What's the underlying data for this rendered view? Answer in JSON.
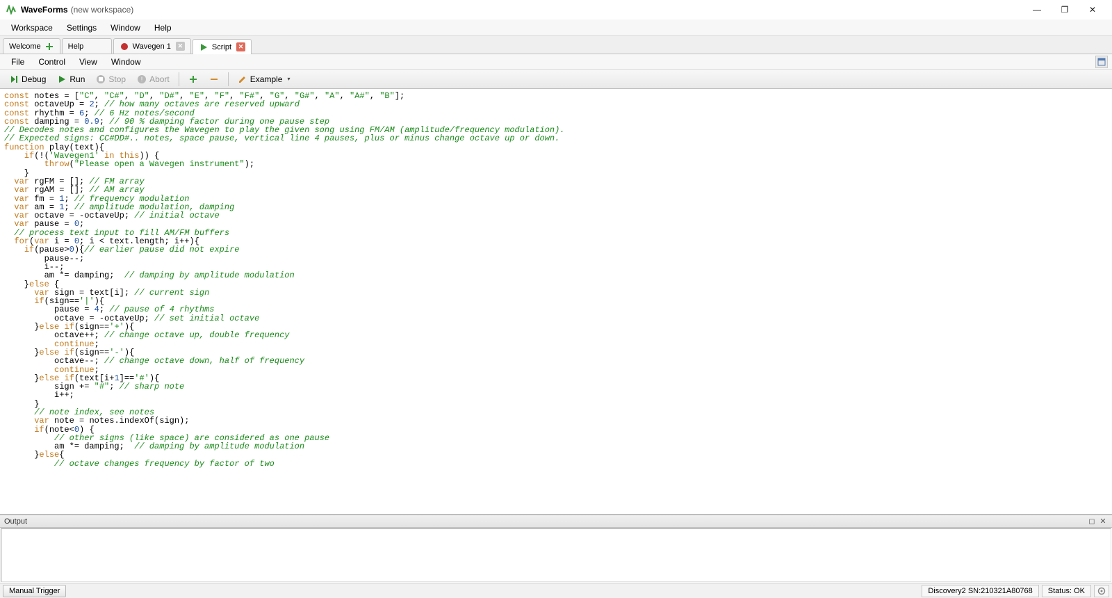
{
  "title": {
    "app": "WaveForms",
    "workspace": "(new workspace)"
  },
  "window_buttons": {
    "min": "—",
    "max": "❐",
    "close": "✕"
  },
  "menubar": [
    "Workspace",
    "Settings",
    "Window",
    "Help"
  ],
  "tabs": [
    {
      "label": "Welcome",
      "icon": "plus-green",
      "active": false,
      "closable": false
    },
    {
      "label": "Help",
      "icon": "",
      "active": false,
      "closable": false
    },
    {
      "label": "Wavegen 1",
      "icon": "record-red",
      "active": false,
      "closable": "grey"
    },
    {
      "label": "Script",
      "icon": "play-green",
      "active": true,
      "closable": "red"
    }
  ],
  "sub_menubar": [
    "File",
    "Control",
    "View",
    "Window"
  ],
  "toolbar": {
    "debug": "Debug",
    "run": "Run",
    "stop": "Stop",
    "abort": "Abort",
    "example": "Example"
  },
  "output": {
    "title": "Output"
  },
  "statusbar": {
    "manual_trigger": "Manual Trigger",
    "device": "Discovery2 SN:210321A80768",
    "status": "Status: OK"
  },
  "code_lines": [
    [
      [
        "kw",
        "const"
      ],
      [
        "",
        "",
        " notes = ["
      ],
      [
        "str",
        "\"C\""
      ],
      [
        "",
        ", "
      ],
      [
        "str",
        "\"C#\""
      ],
      [
        "",
        ", "
      ],
      [
        "str",
        "\"D\""
      ],
      [
        "",
        ", "
      ],
      [
        "str",
        "\"D#\""
      ],
      [
        "",
        ", "
      ],
      [
        "str",
        "\"E\""
      ],
      [
        "",
        ", "
      ],
      [
        "str",
        "\"F\""
      ],
      [
        "",
        ", "
      ],
      [
        "str",
        "\"F#\""
      ],
      [
        "",
        ", "
      ],
      [
        "str",
        "\"G\""
      ],
      [
        "",
        ", "
      ],
      [
        "str",
        "\"G#\""
      ],
      [
        "",
        ", "
      ],
      [
        "str",
        "\"A\""
      ],
      [
        "",
        ", "
      ],
      [
        "str",
        "\"A#\""
      ],
      [
        "",
        ", "
      ],
      [
        "str",
        "\"B\""
      ],
      [
        "",
        "];"
      ]
    ],
    [
      [
        "kw",
        "const"
      ],
      [
        "",
        " octaveUp = "
      ],
      [
        "num",
        "2"
      ],
      [
        "",
        "; "
      ],
      [
        "cm",
        "// how many octaves are reserved upward"
      ]
    ],
    [
      [
        "kw",
        "const"
      ],
      [
        "",
        " rhythm = "
      ],
      [
        "num",
        "6"
      ],
      [
        "",
        "; "
      ],
      [
        "cm",
        "// 6 Hz notes/second"
      ]
    ],
    [
      [
        "kw",
        "const"
      ],
      [
        "",
        " damping = "
      ],
      [
        "num",
        "0.9"
      ],
      [
        "",
        "; "
      ],
      [
        "cm",
        "// 90 % damping factor during one pause step"
      ]
    ],
    [
      [
        "",
        ""
      ]
    ],
    [
      [
        "cm",
        "// Decodes notes and configures the Wavegen to play the given song using FM/AM (amplitude/frequency modulation)."
      ]
    ],
    [
      [
        "cm",
        "// Expected signs: CC#DD#.. notes, space pause, vertical line 4 pauses, plus or minus change octave up or down."
      ]
    ],
    [
      [
        "kw",
        "function"
      ],
      [
        "",
        " "
      ],
      [
        "fn",
        "play"
      ],
      [
        "",
        "(text){"
      ]
    ],
    [
      [
        "",
        "    "
      ],
      [
        "kw",
        "if"
      ],
      [
        "",
        "(!("
      ],
      [
        "str",
        "'Wavegen1'"
      ],
      [
        "",
        " "
      ],
      [
        "kw",
        "in"
      ],
      [
        "",
        " "
      ],
      [
        "kw",
        "this"
      ],
      [
        "",
        ")) {"
      ]
    ],
    [
      [
        "",
        "        "
      ],
      [
        "kw",
        "throw"
      ],
      [
        "",
        "("
      ],
      [
        "str",
        "\"Please open a Wavegen instrument\""
      ],
      [
        "",
        ");"
      ]
    ],
    [
      [
        "",
        "    }"
      ]
    ],
    [
      [
        "",
        "  "
      ],
      [
        "kw",
        "var"
      ],
      [
        "",
        " rgFM = []; "
      ],
      [
        "cm",
        "// FM array"
      ]
    ],
    [
      [
        "",
        "  "
      ],
      [
        "kw",
        "var"
      ],
      [
        "",
        " rgAM = []; "
      ],
      [
        "cm",
        "// AM array"
      ]
    ],
    [
      [
        "",
        "  "
      ],
      [
        "kw",
        "var"
      ],
      [
        "",
        " fm = "
      ],
      [
        "num",
        "1"
      ],
      [
        "",
        "; "
      ],
      [
        "cm",
        "// frequency modulation"
      ]
    ],
    [
      [
        "",
        "  "
      ],
      [
        "kw",
        "var"
      ],
      [
        "",
        " am = "
      ],
      [
        "num",
        "1"
      ],
      [
        "",
        "; "
      ],
      [
        "cm",
        "// amplitude modulation, damping"
      ]
    ],
    [
      [
        "",
        "  "
      ],
      [
        "kw",
        "var"
      ],
      [
        "",
        " octave = -octaveUp; "
      ],
      [
        "cm",
        "// initial octave"
      ]
    ],
    [
      [
        "",
        "  "
      ],
      [
        "kw",
        "var"
      ],
      [
        "",
        " pause = "
      ],
      [
        "num",
        "0"
      ],
      [
        "",
        ";"
      ]
    ],
    [
      [
        "",
        "  "
      ],
      [
        "cm",
        "// process text input to fill AM/FM buffers"
      ]
    ],
    [
      [
        "",
        "  "
      ],
      [
        "kw",
        "for"
      ],
      [
        "",
        "("
      ],
      [
        "kw",
        "var"
      ],
      [
        "",
        " i = "
      ],
      [
        "num",
        "0"
      ],
      [
        "",
        "; i < text.length; i++){"
      ]
    ],
    [
      [
        "",
        ""
      ]
    ],
    [
      [
        "",
        "    "
      ],
      [
        "kw",
        "if"
      ],
      [
        "",
        "(pause>"
      ],
      [
        "num",
        "0"
      ],
      [
        "",
        "){"
      ],
      [
        "cm",
        "// earlier pause did not expire"
      ]
    ],
    [
      [
        "",
        "        pause--;"
      ]
    ],
    [
      [
        "",
        "        i--;"
      ]
    ],
    [
      [
        "",
        "        am *= damping;  "
      ],
      [
        "cm",
        "// damping by amplitude modulation"
      ]
    ],
    [
      [
        "",
        "    }"
      ],
      [
        "kw",
        "else"
      ],
      [
        "",
        " {"
      ]
    ],
    [
      [
        "",
        "      "
      ],
      [
        "kw",
        "var"
      ],
      [
        "",
        " sign = text[i]; "
      ],
      [
        "cm",
        "// current sign"
      ]
    ],
    [
      [
        "",
        "      "
      ],
      [
        "kw",
        "if"
      ],
      [
        "",
        "(sign=="
      ],
      [
        "str",
        "'|'"
      ],
      [
        "",
        "){"
      ]
    ],
    [
      [
        "",
        "          pause = "
      ],
      [
        "num",
        "4"
      ],
      [
        "",
        "; "
      ],
      [
        "cm",
        "// pause of 4 rhythms"
      ]
    ],
    [
      [
        "",
        "          octave = -octaveUp; "
      ],
      [
        "cm",
        "// set initial octave"
      ]
    ],
    [
      [
        "",
        "      }"
      ],
      [
        "kw",
        "else"
      ],
      [
        "",
        " "
      ],
      [
        "kw",
        "if"
      ],
      [
        "",
        "(sign=="
      ],
      [
        "str",
        "'+'"
      ],
      [
        "",
        "){"
      ]
    ],
    [
      [
        "",
        "          octave++; "
      ],
      [
        "cm",
        "// change octave up, double frequency"
      ]
    ],
    [
      [
        "",
        "          "
      ],
      [
        "kw",
        "continue"
      ],
      [
        "",
        ";"
      ]
    ],
    [
      [
        "",
        "      }"
      ],
      [
        "kw",
        "else"
      ],
      [
        "",
        " "
      ],
      [
        "kw",
        "if"
      ],
      [
        "",
        "(sign=="
      ],
      [
        "str",
        "'-'"
      ],
      [
        "",
        "){"
      ]
    ],
    [
      [
        "",
        "          octave--; "
      ],
      [
        "cm",
        "// change octave down, half of frequency"
      ]
    ],
    [
      [
        "",
        "          "
      ],
      [
        "kw",
        "continue"
      ],
      [
        "",
        ";"
      ]
    ],
    [
      [
        "",
        "      }"
      ],
      [
        "kw",
        "else"
      ],
      [
        "",
        " "
      ],
      [
        "kw",
        "if"
      ],
      [
        "",
        "(text[i+"
      ],
      [
        "num",
        "1"
      ],
      [
        "",
        "]=="
      ],
      [
        "str",
        "'#'"
      ],
      [
        "",
        "){"
      ]
    ],
    [
      [
        "",
        "          sign += "
      ],
      [
        "str",
        "\"#\""
      ],
      [
        "",
        "; "
      ],
      [
        "cm",
        "// sharp note"
      ]
    ],
    [
      [
        "",
        "          i++;"
      ]
    ],
    [
      [
        "",
        "      }"
      ]
    ],
    [
      [
        "",
        "      "
      ],
      [
        "cm",
        "// note index, see notes"
      ]
    ],
    [
      [
        "",
        "      "
      ],
      [
        "kw",
        "var"
      ],
      [
        "",
        " note = notes.indexOf(sign);"
      ]
    ],
    [
      [
        "",
        "      "
      ],
      [
        "kw",
        "if"
      ],
      [
        "",
        "(note<"
      ],
      [
        "num",
        "0"
      ],
      [
        "",
        ") {"
      ]
    ],
    [
      [
        "",
        "          "
      ],
      [
        "cm",
        "// other signs (like space) are considered as one pause"
      ]
    ],
    [
      [
        "",
        "          am *= damping;  "
      ],
      [
        "cm",
        "// damping by amplitude modulation"
      ]
    ],
    [
      [
        "",
        "      }"
      ],
      [
        "kw",
        "else"
      ],
      [
        "",
        "{"
      ]
    ],
    [
      [
        "",
        "          "
      ],
      [
        "cm",
        "// octave changes frequency by factor of two"
      ]
    ]
  ]
}
